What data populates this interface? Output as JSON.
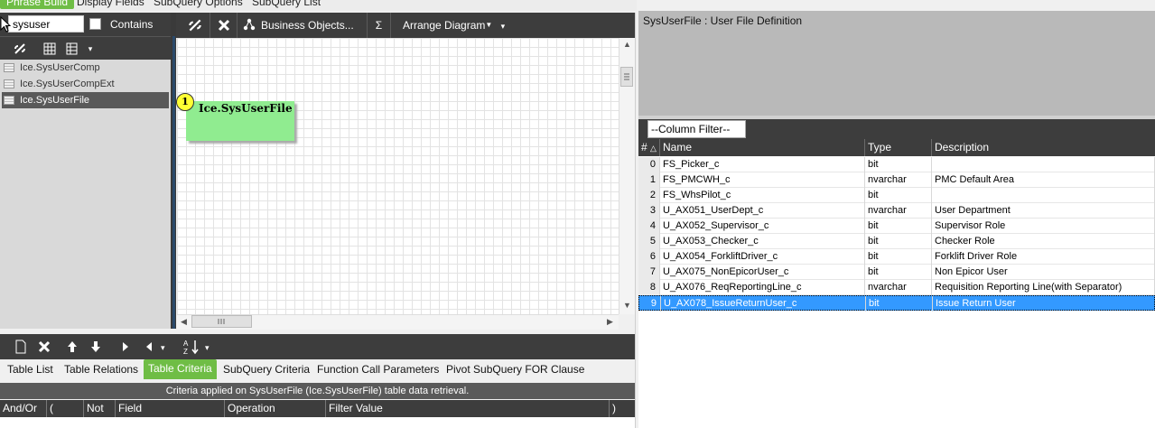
{
  "menu_tabs": [
    {
      "label": "Phrase Build",
      "active": true
    },
    {
      "label": "Display Fields"
    },
    {
      "label": "SubQuery Options"
    },
    {
      "label": "SubQuery List"
    }
  ],
  "search": {
    "value": "sysuser",
    "contains_label": "Contains"
  },
  "tree_items": [
    "Ice.SysUserComp",
    "Ice.SysUserCompExt",
    "Ice.SysUserFile"
  ],
  "diagram_toolbar": {
    "business_objects": "Business Objects...",
    "sigma": "Σ",
    "arrange": "Arrange Diagram"
  },
  "diagram_node": {
    "badge": "1",
    "title": "Ice.SysUserFile"
  },
  "sub_tabs": [
    "Table List",
    "Table Relations",
    "Table Criteria",
    "SubQuery Criteria",
    "Function Call Parameters",
    "Pivot SubQuery FOR Clause"
  ],
  "criteria": {
    "banner": "Criteria applied on SysUserFile (Ice.SysUserFile)  table data retrieval.",
    "columns": [
      "And/Or",
      "(",
      "Not",
      "Field",
      "Operation",
      "Filter Value",
      ")"
    ]
  },
  "description": "SysUserFile : User File Definition",
  "column_filter": "--Column Filter--",
  "grid": {
    "headers": {
      "num": "#",
      "name": "Name",
      "type": "Type",
      "desc": "Description"
    },
    "rows": [
      {
        "n": "0",
        "name": "FS_Picker_c",
        "type": "bit",
        "desc": ""
      },
      {
        "n": "1",
        "name": "FS_PMCWH_c",
        "type": "nvarchar",
        "desc": "PMC Default Area"
      },
      {
        "n": "2",
        "name": "FS_WhsPilot_c",
        "type": "bit",
        "desc": ""
      },
      {
        "n": "3",
        "name": "U_AX051_UserDept_c",
        "type": "nvarchar",
        "desc": "User Department"
      },
      {
        "n": "4",
        "name": "U_AX052_Supervisor_c",
        "type": "bit",
        "desc": "Supervisor Role"
      },
      {
        "n": "5",
        "name": "U_AX053_Checker_c",
        "type": "bit",
        "desc": "Checker Role"
      },
      {
        "n": "6",
        "name": "U_AX054_ForkliftDriver_c",
        "type": "bit",
        "desc": "Forklift Driver Role"
      },
      {
        "n": "7",
        "name": "U_AX075_NonEpicorUser_c",
        "type": "bit",
        "desc": "Non Epicor User"
      },
      {
        "n": "8",
        "name": "U_AX076_ReqReportingLine_c",
        "type": "nvarchar",
        "desc": "Requisition Reporting Line(with Separator)"
      },
      {
        "n": "9",
        "name": "U_AX078_IssueReturnUser_c",
        "type": "bit",
        "desc": "Issue Return User"
      }
    ]
  },
  "colors": {
    "accent": "#6fbd45",
    "selection": "#3399ff",
    "node": "#90ec90",
    "badge": "#ffff33"
  }
}
